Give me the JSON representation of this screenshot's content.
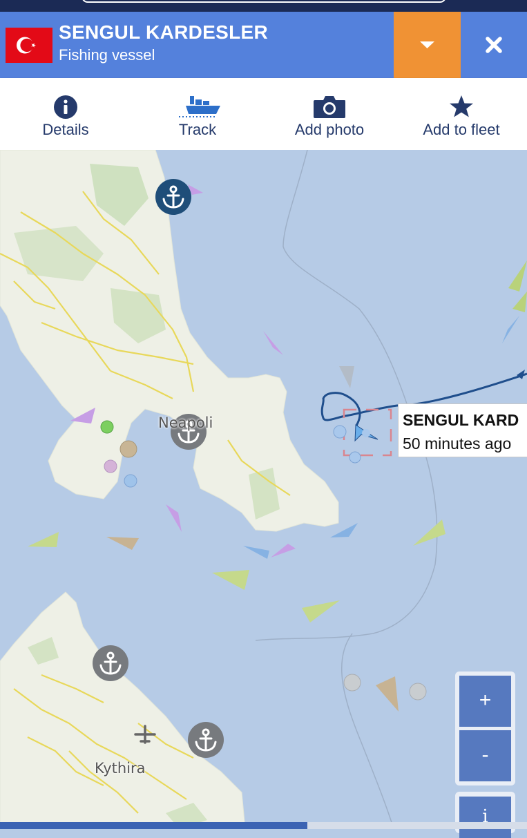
{
  "vessel": {
    "name": "SENGUL KARDESLER",
    "type": "Fishing vessel",
    "flag_icon": "turkey-flag-icon"
  },
  "toolbar": {
    "items": [
      {
        "label": "Details",
        "icon": "info-icon"
      },
      {
        "label": "Track",
        "icon": "ship-track-icon"
      },
      {
        "label": "Add photo",
        "icon": "camera-icon"
      },
      {
        "label": "Add to fleet",
        "icon": "star-icon"
      }
    ]
  },
  "map": {
    "places": {
      "neapoli": "Neapoli",
      "kythira": "Kythira"
    },
    "vessel_label": {
      "name": "SENGUL KARD",
      "last_seen": "50 minutes ago"
    },
    "zoom": {
      "in_label": "+",
      "out_label": "-",
      "info_label": "i"
    }
  },
  "colors": {
    "header_blue": "#5481dc",
    "dropdown_orange": "#f09234",
    "sea": "#b6cbe6",
    "land": "#eef0e6",
    "track": "#1f4e8c"
  }
}
